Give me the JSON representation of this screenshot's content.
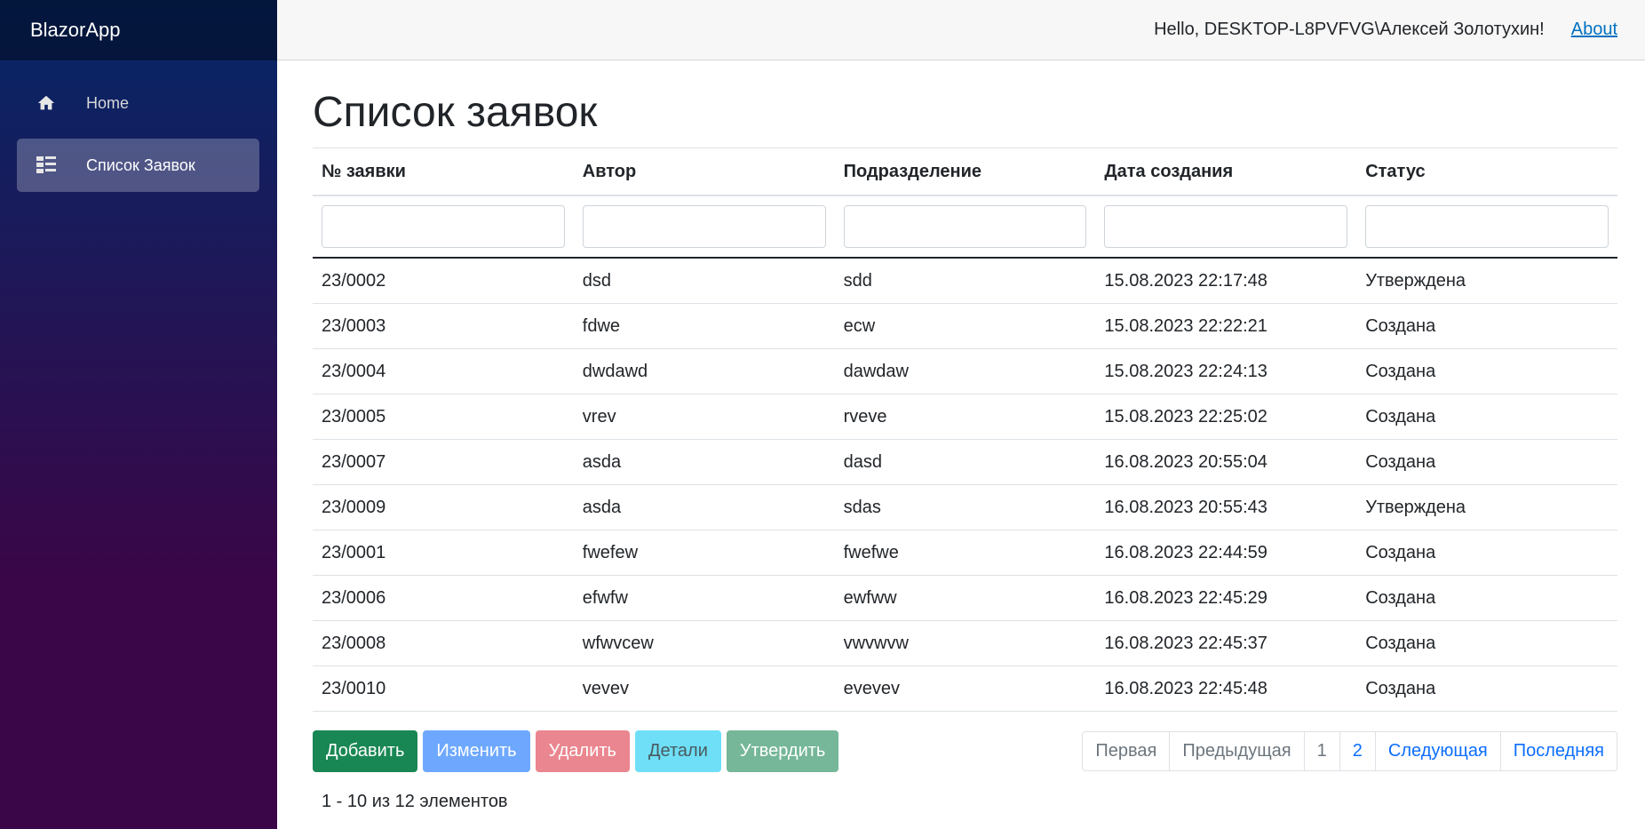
{
  "app": {
    "brand": "BlazorApp"
  },
  "sidebar": {
    "items": [
      {
        "label": "Home",
        "icon": "home-icon",
        "active": false
      },
      {
        "label": "Список Заявок",
        "icon": "list-icon",
        "active": true
      }
    ]
  },
  "header": {
    "greeting": "Hello, DESKTOP-L8PVFVG\\Алексей Золотухин!",
    "about_label": "About"
  },
  "main": {
    "title": "Список заявок",
    "table": {
      "columns": [
        "№ заявки",
        "Автор",
        "Подразделение",
        "Дата создания",
        "Статус"
      ],
      "filters": [
        "",
        "",
        "",
        "",
        ""
      ],
      "rows": [
        [
          "23/0002",
          "dsd",
          "sdd",
          "15.08.2023 22:17:48",
          "Утверждена"
        ],
        [
          "23/0003",
          "fdwe",
          "ecw",
          "15.08.2023 22:22:21",
          "Создана"
        ],
        [
          "23/0004",
          "dwdawd",
          "dawdaw",
          "15.08.2023 22:24:13",
          "Создана"
        ],
        [
          "23/0005",
          "vrev",
          "rveve",
          "15.08.2023 22:25:02",
          "Создана"
        ],
        [
          "23/0007",
          "asda",
          "dasd",
          "16.08.2023 20:55:04",
          "Создана"
        ],
        [
          "23/0009",
          "asda",
          "sdas",
          "16.08.2023 20:55:43",
          "Утверждена"
        ],
        [
          "23/0001",
          "fwefew",
          "fwefwe",
          "16.08.2023 22:44:59",
          "Создана"
        ],
        [
          "23/0006",
          "efwfw",
          "ewfww",
          "16.08.2023 22:45:29",
          "Создана"
        ],
        [
          "23/0008",
          "wfwvcew",
          "vwvwvw",
          "16.08.2023 22:45:37",
          "Создана"
        ],
        [
          "23/0010",
          "vevev",
          "evevev",
          "16.08.2023 22:45:48",
          "Создана"
        ]
      ]
    },
    "buttons": {
      "add": "Добавить",
      "edit": "Изменить",
      "delete": "Удалить",
      "details": "Детали",
      "approve": "Утвердить"
    },
    "pager": {
      "first": "Первая",
      "prev": "Предыдущая",
      "pages": [
        "1",
        "2"
      ],
      "current_page": "1",
      "next": "Следующая",
      "last": "Последняя"
    },
    "summary": "1 - 10 из 12 элементов"
  },
  "colors": {
    "sidebar_top": "#052767",
    "sidebar_bottom": "#3a0647",
    "add": "#198754",
    "edit": "#6ea8fe",
    "delete": "#ea868f",
    "details": "#6edff6",
    "approve": "#75b798",
    "link": "#0d6efd"
  }
}
